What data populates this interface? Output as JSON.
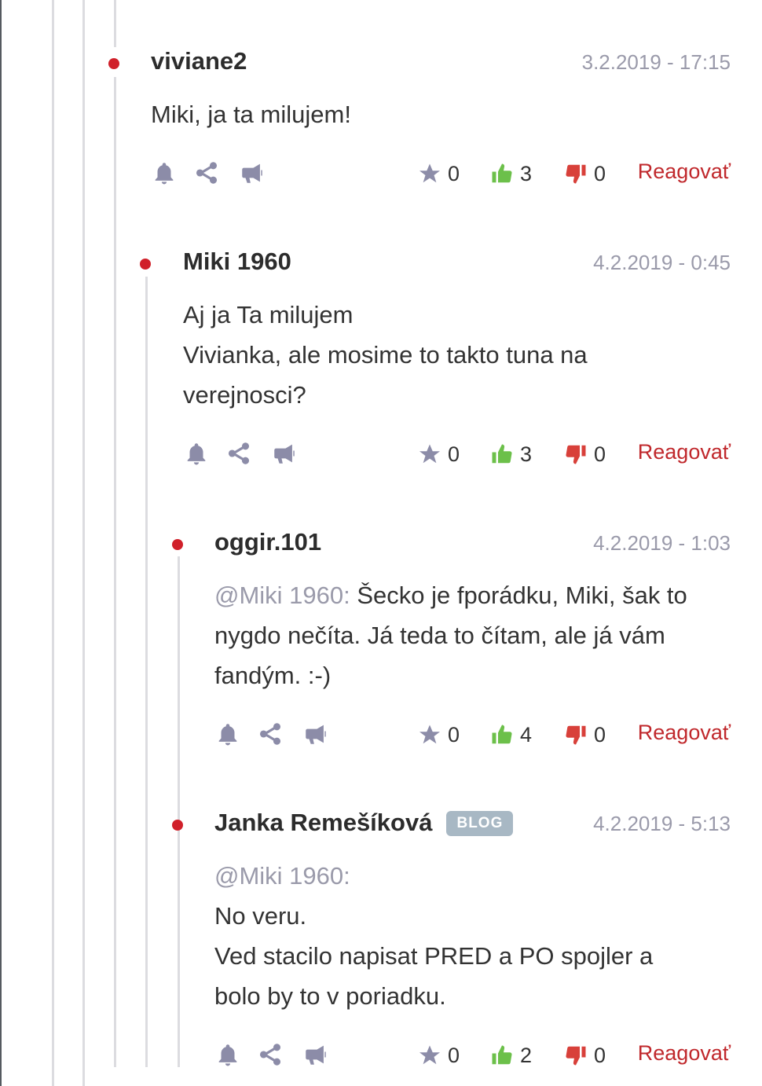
{
  "comments": [
    {
      "author": "viviane2",
      "date": "3.2.2019 - 17:15",
      "mention": "",
      "lines": [
        "Miki, ja ta milujem!"
      ],
      "stars": "0",
      "likes": "3",
      "dislikes": "0",
      "reply_label": "Reagovať"
    },
    {
      "author": "Miki 1960",
      "date": "4.2.2019 - 0:45",
      "mention": "",
      "lines": [
        "Aj ja Ta milujem",
        "Vivianka, ale mosime to takto tuna na",
        "verejnosci?"
      ],
      "stars": "0",
      "likes": "3",
      "dislikes": "0",
      "reply_label": "Reagovať"
    },
    {
      "author": "oggir.101",
      "date": "4.2.2019 - 1:03",
      "mention": "@Miki 1960:",
      "lines": [
        " Šecko je fporádku, Miki, šak to",
        "nygdo nečíta. Já teda to čítam, ale já vám",
        "fandým. :-)"
      ],
      "stars": "0",
      "likes": "4",
      "dislikes": "0",
      "reply_label": "Reagovať"
    },
    {
      "author": "Janka Remešíková",
      "badge": "BLOG",
      "date": "4.2.2019 - 5:13",
      "mention": "@Miki 1960:",
      "lines": [
        "No veru.",
        "Ved stacilo napisat PRED a PO spojler a",
        "bolo by to v poriadku."
      ],
      "stars": "0",
      "likes": "2",
      "dislikes": "0",
      "reply_label": "Reagovať"
    }
  ],
  "icons": {
    "bell": "bell-icon",
    "share": "share-icon",
    "megaphone": "megaphone-icon",
    "star": "star-icon",
    "thumbs_up": "thumbs-up-icon",
    "thumbs_down": "thumbs-down-icon"
  },
  "colors": {
    "dot": "#d0202a",
    "reply": "#c0282c",
    "like": "#6cc04a",
    "dislike": "#d8403a",
    "icon": "#8c8ca8",
    "muted": "#9a9aaa"
  }
}
